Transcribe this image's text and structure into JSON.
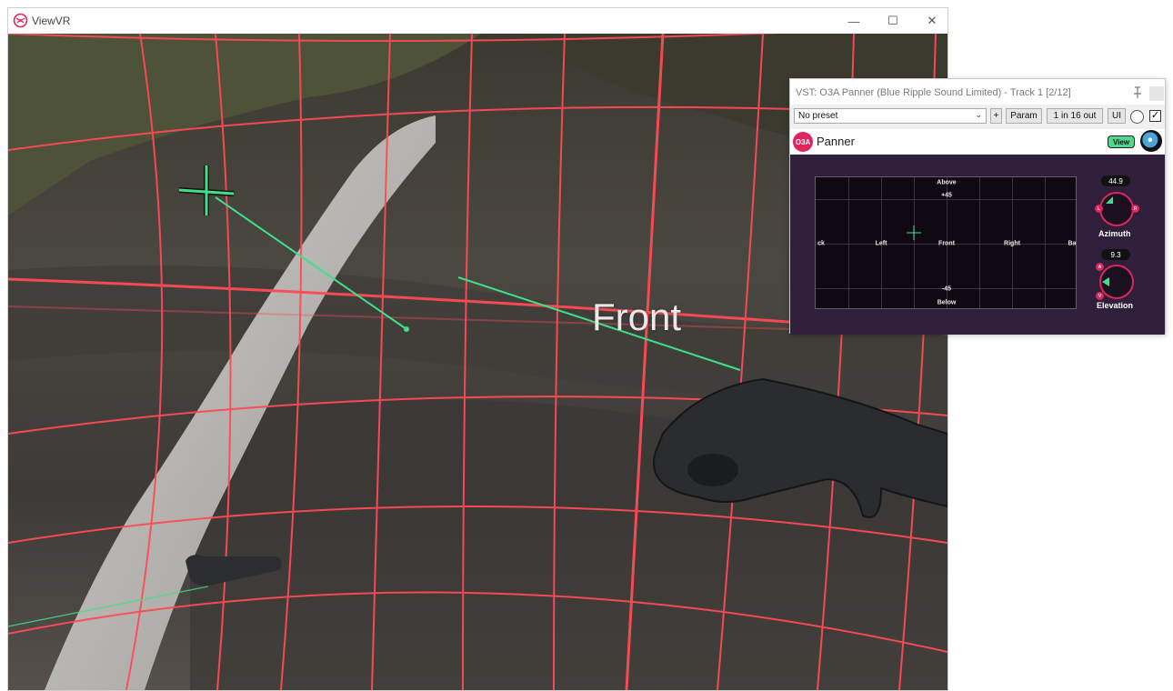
{
  "viewvr": {
    "title": "ViewVR",
    "controls": {
      "minimize": "—",
      "maximize": "☐",
      "close": "✕"
    },
    "scene": {
      "direction_label": "Front",
      "grid_color": "#ff4a55",
      "pointer_color": "#3fe08a"
    }
  },
  "vst": {
    "title": "VST: O3A Panner (Blue Ripple Sound Limited) - Track 1 [2/12]",
    "toolbar": {
      "preset": "No preset",
      "plus_label": "+",
      "param_label": "Param",
      "io_label": "1 in 16 out",
      "ui_label": "UI",
      "bypass_checked": "✓"
    },
    "header": {
      "logo_text": "O3A",
      "plugin_name": "Panner",
      "view_button": "View"
    },
    "panner": {
      "labels": {
        "above": "Above",
        "plus45": "+45",
        "back_left": "ck",
        "left": "Left",
        "front": "Front",
        "right": "Right",
        "back_right": "Ba",
        "minus45": "-45",
        "below": "Below"
      },
      "azimuth": {
        "value": "44.9",
        "label": "Azimuth",
        "left_marker": "L",
        "right_marker": "R"
      },
      "elevation": {
        "value": "9.3",
        "label": "Elevation",
        "up_marker": "A",
        "down_marker": "V"
      }
    },
    "accent_color": "#e0245e",
    "view_color": "#4fd88a"
  }
}
